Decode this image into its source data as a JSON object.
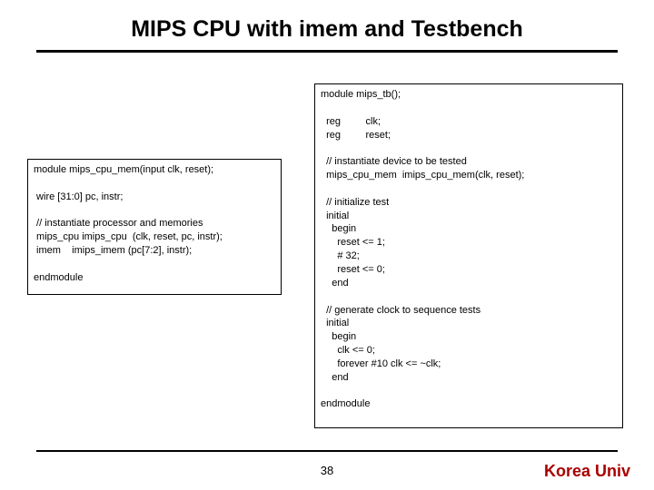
{
  "title": "MIPS CPU with imem and Testbench",
  "left_code": "module mips_cpu_mem(input clk, reset);\n\n wire [31:0] pc, instr;\n\n // instantiate processor and memories\n mips_cpu imips_cpu  (clk, reset, pc, instr);\n imem    imips_imem (pc[7:2], instr);\n\nendmodule",
  "right_code": "module mips_tb();\n\n  reg         clk;\n  reg         reset;\n\n  // instantiate device to be tested\n  mips_cpu_mem  imips_cpu_mem(clk, reset);\n\n  // initialize test\n  initial\n    begin\n      reset <= 1;\n      # 32;\n      reset <= 0;\n    end\n\n  // generate clock to sequence tests\n  initial\n    begin\n      clk <= 0;\n      forever #10 clk <= ~clk;\n    end\n\nendmodule",
  "page_number": "38",
  "brand": "Korea Univ"
}
